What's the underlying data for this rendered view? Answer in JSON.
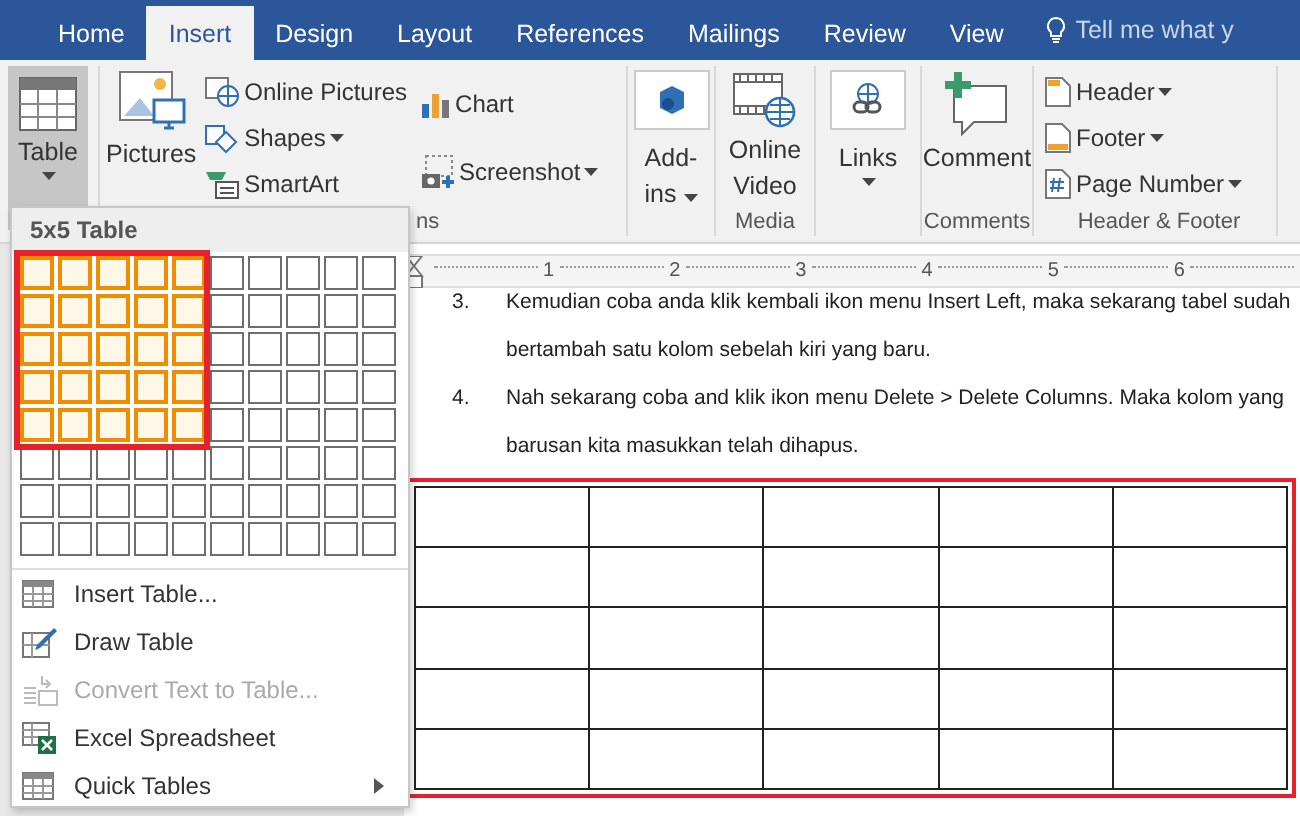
{
  "tabs": [
    {
      "label": "Home",
      "selected": false
    },
    {
      "label": "Insert",
      "selected": true
    },
    {
      "label": "Design",
      "selected": false
    },
    {
      "label": "Layout",
      "selected": false
    },
    {
      "label": "References",
      "selected": false
    },
    {
      "label": "Mailings",
      "selected": false
    },
    {
      "label": "Review",
      "selected": false
    },
    {
      "label": "View",
      "selected": false
    }
  ],
  "tell_me": "Tell me what y",
  "ribbon": {
    "table": {
      "label": "Table",
      "pressed": true
    },
    "illustrations": {
      "pictures": "Pictures",
      "online_pictures": "Online Pictures",
      "shapes": "Shapes",
      "smartart": "SmartArt",
      "chart": "Chart",
      "screenshot": "Screenshot",
      "group_label": "ns"
    },
    "addins": {
      "line_1": "Add-",
      "line_2": "ins"
    },
    "media": {
      "line_1": "Online",
      "line_2": "Video",
      "group_label": "Media"
    },
    "links": {
      "label": "Links"
    },
    "comments": {
      "label": "Comment",
      "group_label": "Comments"
    },
    "header_footer": {
      "header": "Header",
      "footer": "Footer",
      "page_number": "Page Number",
      "group_label": "Header & Footer"
    }
  },
  "table_menu": {
    "title": "5x5 Table",
    "grid_rows": [
      {
        "cells": [
          {
            "selected": true
          },
          {
            "selected": true
          },
          {
            "selected": true
          },
          {
            "selected": true
          },
          {
            "selected": true
          },
          {
            "selected": false
          },
          {
            "selected": false
          },
          {
            "selected": false
          },
          {
            "selected": false
          },
          {
            "selected": false
          }
        ]
      },
      {
        "cells": [
          {
            "selected": true
          },
          {
            "selected": true
          },
          {
            "selected": true
          },
          {
            "selected": true
          },
          {
            "selected": true
          },
          {
            "selected": false
          },
          {
            "selected": false
          },
          {
            "selected": false
          },
          {
            "selected": false
          },
          {
            "selected": false
          }
        ]
      },
      {
        "cells": [
          {
            "selected": true
          },
          {
            "selected": true
          },
          {
            "selected": true
          },
          {
            "selected": true
          },
          {
            "selected": true
          },
          {
            "selected": false
          },
          {
            "selected": false
          },
          {
            "selected": false
          },
          {
            "selected": false
          },
          {
            "selected": false
          }
        ]
      },
      {
        "cells": [
          {
            "selected": true
          },
          {
            "selected": true
          },
          {
            "selected": true
          },
          {
            "selected": true
          },
          {
            "selected": true
          },
          {
            "selected": false
          },
          {
            "selected": false
          },
          {
            "selected": false
          },
          {
            "selected": false
          },
          {
            "selected": false
          }
        ]
      },
      {
        "cells": [
          {
            "selected": true
          },
          {
            "selected": true
          },
          {
            "selected": true
          },
          {
            "selected": true
          },
          {
            "selected": true
          },
          {
            "selected": false
          },
          {
            "selected": false
          },
          {
            "selected": false
          },
          {
            "selected": false
          },
          {
            "selected": false
          }
        ]
      },
      {
        "cells": [
          {
            "selected": false
          },
          {
            "selected": false
          },
          {
            "selected": false
          },
          {
            "selected": false
          },
          {
            "selected": false
          },
          {
            "selected": false
          },
          {
            "selected": false
          },
          {
            "selected": false
          },
          {
            "selected": false
          },
          {
            "selected": false
          }
        ]
      },
      {
        "cells": [
          {
            "selected": false
          },
          {
            "selected": false
          },
          {
            "selected": false
          },
          {
            "selected": false
          },
          {
            "selected": false
          },
          {
            "selected": false
          },
          {
            "selected": false
          },
          {
            "selected": false
          },
          {
            "selected": false
          },
          {
            "selected": false
          }
        ]
      },
      {
        "cells": [
          {
            "selected": false
          },
          {
            "selected": false
          },
          {
            "selected": false
          },
          {
            "selected": false
          },
          {
            "selected": false
          },
          {
            "selected": false
          },
          {
            "selected": false
          },
          {
            "selected": false
          },
          {
            "selected": false
          },
          {
            "selected": false
          }
        ]
      }
    ],
    "items": [
      {
        "kind": "insert",
        "label": "Insert Table...",
        "disabled": false,
        "submenu": false
      },
      {
        "kind": "draw",
        "label": "Draw Table",
        "disabled": false,
        "submenu": false
      },
      {
        "kind": "convert",
        "label": "Convert Text to Table...",
        "disabled": true,
        "submenu": false
      },
      {
        "kind": "excel",
        "label": "Excel Spreadsheet",
        "disabled": false,
        "submenu": false
      },
      {
        "kind": "quick",
        "label": "Quick Tables",
        "disabled": false,
        "submenu": true
      }
    ]
  },
  "ruler": [
    "1",
    "2",
    "3",
    "4",
    "5",
    "6"
  ],
  "document": {
    "list": [
      {
        "number": "3.",
        "lines": [
          "Kemudian coba anda klik kembali ikon menu Insert Left, maka sekarang tabel sudah",
          "bertambah satu kolom sebelah kiri yang baru."
        ]
      },
      {
        "number": "4.",
        "lines": [
          "Nah sekarang coba and klik ikon menu Delete > Delete Columns. Maka kolom yang",
          "barusan kita masukkan telah dihapus."
        ]
      }
    ]
  }
}
